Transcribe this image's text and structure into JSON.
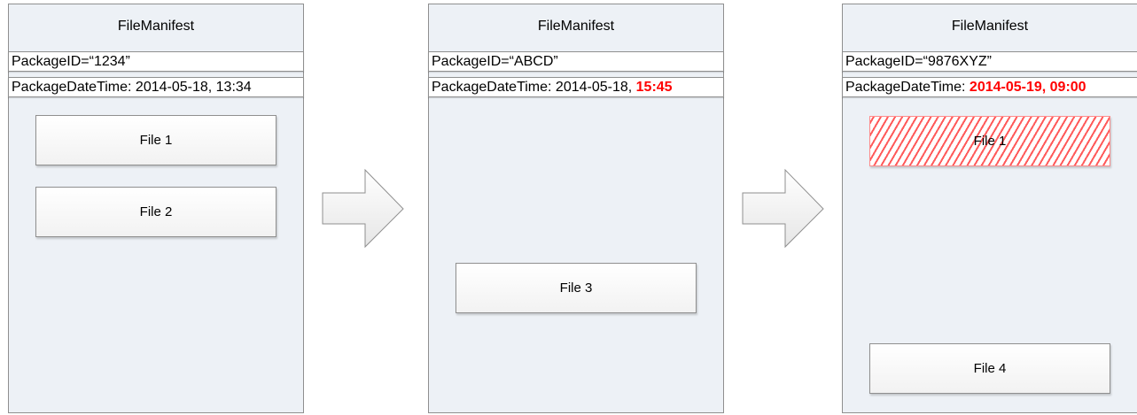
{
  "panels": [
    {
      "title": "FileManifest",
      "package_id": "PackageID=“1234”",
      "datetime_label": "PackageDateTime: ",
      "datetime_plain": "2014-05-18, 13:34",
      "datetime_changed": "",
      "files": [
        {
          "label": "File 1",
          "deleted": false
        },
        {
          "label": "File 2",
          "deleted": false
        }
      ]
    },
    {
      "title": "FileManifest",
      "package_id": "PackageID=“ABCD”",
      "datetime_label": "PackageDateTime: ",
      "datetime_plain": "2014-05-18, ",
      "datetime_changed": "15:45",
      "files": [
        {
          "label": "File 3",
          "deleted": false
        }
      ]
    },
    {
      "title": "FileManifest",
      "package_id": "PackageID=“9876XYZ”",
      "datetime_label": "PackageDateTime: ",
      "datetime_plain": "",
      "datetime_changed": "2014-05-19, 09:00",
      "files": [
        {
          "label": "File 1",
          "deleted": true
        },
        {
          "label": "File 4",
          "deleted": false
        }
      ]
    }
  ],
  "colors": {
    "changed_text": "#ff0000",
    "deleted_hatch": "#ff5a5a",
    "panel_fill": "#edf1f6"
  }
}
